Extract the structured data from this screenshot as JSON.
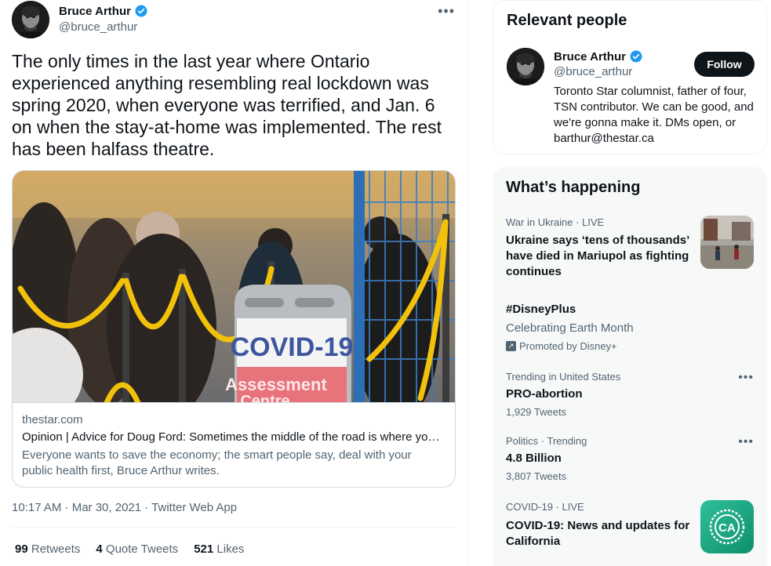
{
  "tweet": {
    "author_name": "Bruce Arthur",
    "author_handle": "@bruce_arthur",
    "more_icon": "more-icon",
    "text": "The only times in the last year where Ontario experienced anything resembling real lockdown was spring 2020, when everyone was terrified, and Jan. 6 on when the stay-at-home was implemented. The rest has been halfass theatre.",
    "card": {
      "image_sign_line1": "COVID-19",
      "image_sign_line2": "Assessment",
      "image_sign_line3": "Centre",
      "domain": "thestar.com",
      "title": "Opinion | Advice for Doug Ford: Sometimes the middle of the road is where you …",
      "description": "Everyone wants to save the economy; the smart people say, deal with your public health first, Bruce Arthur writes."
    },
    "timestamp": "10:17 AM · Mar 30, 2021 · Twitter Web App",
    "stats": {
      "retweets_count": "99",
      "retweets_label": "Retweets",
      "quotes_count": "4",
      "quotes_label": "Quote Tweets",
      "likes_count": "521",
      "likes_label": "Likes"
    }
  },
  "relevant_people": {
    "title": "Relevant people",
    "person": {
      "name": "Bruce Arthur",
      "handle": "@bruce_arthur",
      "follow_label": "Follow",
      "bio": "Toronto Star columnist, father of four, TSN contributor. We can be good, and we're gonna make it. DMs open, or barthur@thestar.ca"
    }
  },
  "whats_happening": {
    "title": "What’s happening",
    "trends": [
      {
        "meta": "War in Ukraine · LIVE",
        "title": "Ukraine says ‘tens of thousands’ have died in Mariupol as fighting continues"
      },
      {
        "title": "#DisneyPlus",
        "subtitle": "Celebrating Earth Month",
        "promoted": "Promoted by Disney+"
      },
      {
        "meta": "Trending in United States",
        "title": "PRO-abortion",
        "count": "1,929 Tweets"
      },
      {
        "meta": "Politics · Trending",
        "title": "4.8 Billion",
        "count": "3,807 Tweets"
      },
      {
        "meta": "COVID-19 · LIVE",
        "title": "COVID-19: News and updates for California",
        "thumb_label": "CA"
      }
    ]
  },
  "colors": {
    "text_primary": "#0f1419",
    "text_secondary": "#536471",
    "verified_blue": "#1d9bf0",
    "border": "#cfd9de",
    "sidebar_bg": "#f7f9f9"
  }
}
